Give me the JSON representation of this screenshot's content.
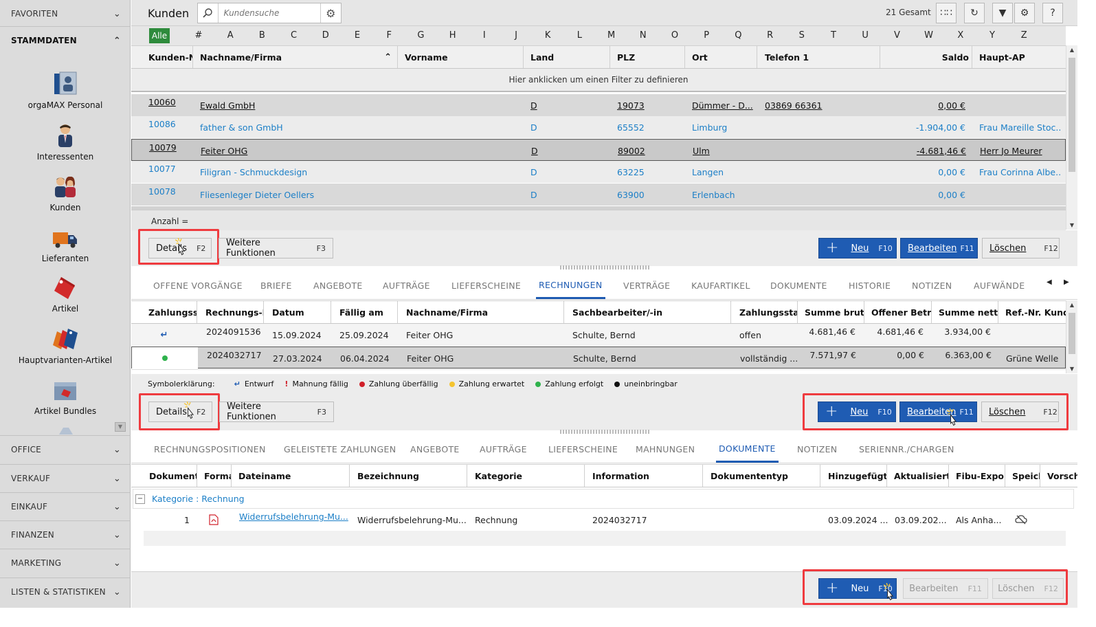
{
  "sidebar": {
    "favoriten": "FAVORITEN",
    "stammdaten": "STAMMDATEN",
    "items": [
      {
        "label": "orgaMAX Personal",
        "icon": "personal-icon"
      },
      {
        "label": "Interessenten",
        "icon": "interessenten-icon"
      },
      {
        "label": "Kunden",
        "icon": "kunden-icon"
      },
      {
        "label": "Lieferanten",
        "icon": "lieferanten-icon"
      },
      {
        "label": "Artikel",
        "icon": "artikel-icon"
      },
      {
        "label": "Hauptvarianten-Artikel",
        "icon": "hauptvarianten-icon"
      },
      {
        "label": "Artikel Bundles",
        "icon": "bundles-icon"
      }
    ],
    "sections": [
      "OFFICE",
      "VERKAUF",
      "EINKAUF",
      "FINANZEN",
      "MARKETING",
      "LISTEN & STATISTIKEN"
    ]
  },
  "toolbar": {
    "title": "Kunden",
    "search_placeholder": "Kundensuche",
    "total": "21 Gesamt"
  },
  "alphabet": {
    "all": "Alle",
    "letters": [
      "#",
      "A",
      "B",
      "C",
      "D",
      "E",
      "F",
      "G",
      "H",
      "I",
      "J",
      "K",
      "L",
      "M",
      "N",
      "O",
      "P",
      "Q",
      "R",
      "S",
      "T",
      "U",
      "V",
      "W",
      "X",
      "Y",
      "Z"
    ]
  },
  "customers": {
    "columns": [
      "Kunden-N",
      "Nachname/Firma",
      "Vorname",
      "Land",
      "PLZ",
      "Ort",
      "Telefon 1",
      "Saldo",
      "Haupt-AP"
    ],
    "filter_hint": "Hier anklicken um einen Filter zu definieren",
    "rows": [
      {
        "nr": "10060",
        "name": "Ewald GmbH",
        "vorname": "",
        "land": "D",
        "plz": "19073",
        "ort": "Dümmer - D...",
        "tel": "03869 66361",
        "saldo": "0,00 €",
        "ap": ""
      },
      {
        "nr": "10086",
        "name": "father & son GmbH",
        "vorname": "",
        "land": "D",
        "plz": "65552",
        "ort": "Limburg",
        "tel": "",
        "saldo": "-1.904,00 €",
        "ap": "Frau Mareille Stoc..."
      },
      {
        "nr": "10079",
        "name": "Feiter OHG",
        "vorname": "",
        "land": "D",
        "plz": "89002",
        "ort": "Ulm",
        "tel": "",
        "saldo": "-4.681,46 €",
        "ap": "Herr Jo Meurer"
      },
      {
        "nr": "10077",
        "name": "Filigran - Schmuckdesign",
        "vorname": "",
        "land": "D",
        "plz": "63225",
        "ort": "Langen",
        "tel": "",
        "saldo": "0,00 €",
        "ap": "Frau Corinna Albe..."
      },
      {
        "nr": "10078",
        "name": "Fliesenleger Dieter Oellers",
        "vorname": "",
        "land": "D",
        "plz": "63900",
        "ort": "Erlenbach",
        "tel": "",
        "saldo": "0,00 €",
        "ap": ""
      }
    ],
    "count_label": "Anzahl ="
  },
  "buttons": {
    "details": "Details",
    "details_key": "F2",
    "weitere": "Weitere Funktionen",
    "weitere_key": "F3",
    "neu": "Neu",
    "neu_key": "F10",
    "bearbeiten": "Bearbeiten",
    "bearbeiten_key": "F11",
    "loeschen": "Löschen",
    "loeschen_key": "F12"
  },
  "tabs1": [
    "OFFENE VORGÄNGE",
    "BRIEFE",
    "ANGEBOTE",
    "AUFTRÄGE",
    "LIEFERSCHEINE",
    "RECHNUNGEN",
    "VERTRÄGE",
    "KAUFARTIKEL",
    "DOKUMENTE",
    "HISTORIE",
    "NOTIZEN",
    "AUFWÄNDE"
  ],
  "invoices": {
    "columns": [
      "Zahlungssta",
      "Rechnungs-Nr",
      "Datum",
      "Fällig am",
      "Nachname/Firma",
      "Sachbearbeiter/-in",
      "Zahlungsstatu",
      "Summe brutto",
      "Offener Betrag",
      "Summe netto",
      "Ref.-Nr. Kunde"
    ],
    "rows": [
      {
        "nr": "2024091536",
        "datum": "15.09.2024",
        "faellig": "25.09.2024",
        "name": "Feiter OHG",
        "sb": "Schulte, Bernd",
        "status": "offen",
        "brutto": "4.681,46 €",
        "offen": "4.681,46 €",
        "netto": "3.934,00 €",
        "ref": ""
      },
      {
        "nr": "2024032717",
        "datum": "27.03.2024",
        "faellig": "06.04.2024",
        "name": "Feiter OHG",
        "sb": "Schulte, Bernd",
        "status": "vollständig ...",
        "brutto": "7.571,97 €",
        "offen": "0,00 €",
        "netto": "6.363,00 €",
        "ref": "Grüne Welle"
      }
    ]
  },
  "legend": {
    "title": "Symbolerklärung:",
    "items": [
      "Entwurf",
      "Mahnung fällig",
      "Zahlung überfällig",
      "Zahlung erwartet",
      "Zahlung erfolgt",
      "uneinbringbar"
    ],
    "colors": [
      "#1f5cb3",
      "#d0202a",
      "#d0202a",
      "#f4c430",
      "#2fb24c",
      "#111111"
    ]
  },
  "tabs2": [
    "RECHNUNGSPOSITIONEN",
    "GELEISTETE ZAHLUNGEN",
    "ANGEBOTE",
    "AUFTRÄGE",
    "LIEFERSCHEINE",
    "MAHNUNGEN",
    "DOKUMENTE",
    "NOTIZEN",
    "SERIENNR./CHARGEN"
  ],
  "documents": {
    "columns": [
      "Dokumente",
      "Forma",
      "Dateiname",
      "Bezeichnung",
      "Kategorie",
      "Information",
      "Dokumententyp",
      "Hinzugefügt a",
      "Aktualisiert a",
      "Fibu-Export",
      "Speich",
      "Vorsch"
    ],
    "group": "Kategorie : Rechnung",
    "group_toggle": "−",
    "rows": [
      {
        "nr": "1",
        "file": "Widerrufsbelehrung-Mu...",
        "bez": "Widerrufsbelehrung-Mu...",
        "kat": "Rechnung",
        "info": "2024032717",
        "typ": "",
        "added": "03.09.2024 ...",
        "updated": "03.09.202...",
        "fibu": "Als Anha..."
      }
    ]
  }
}
